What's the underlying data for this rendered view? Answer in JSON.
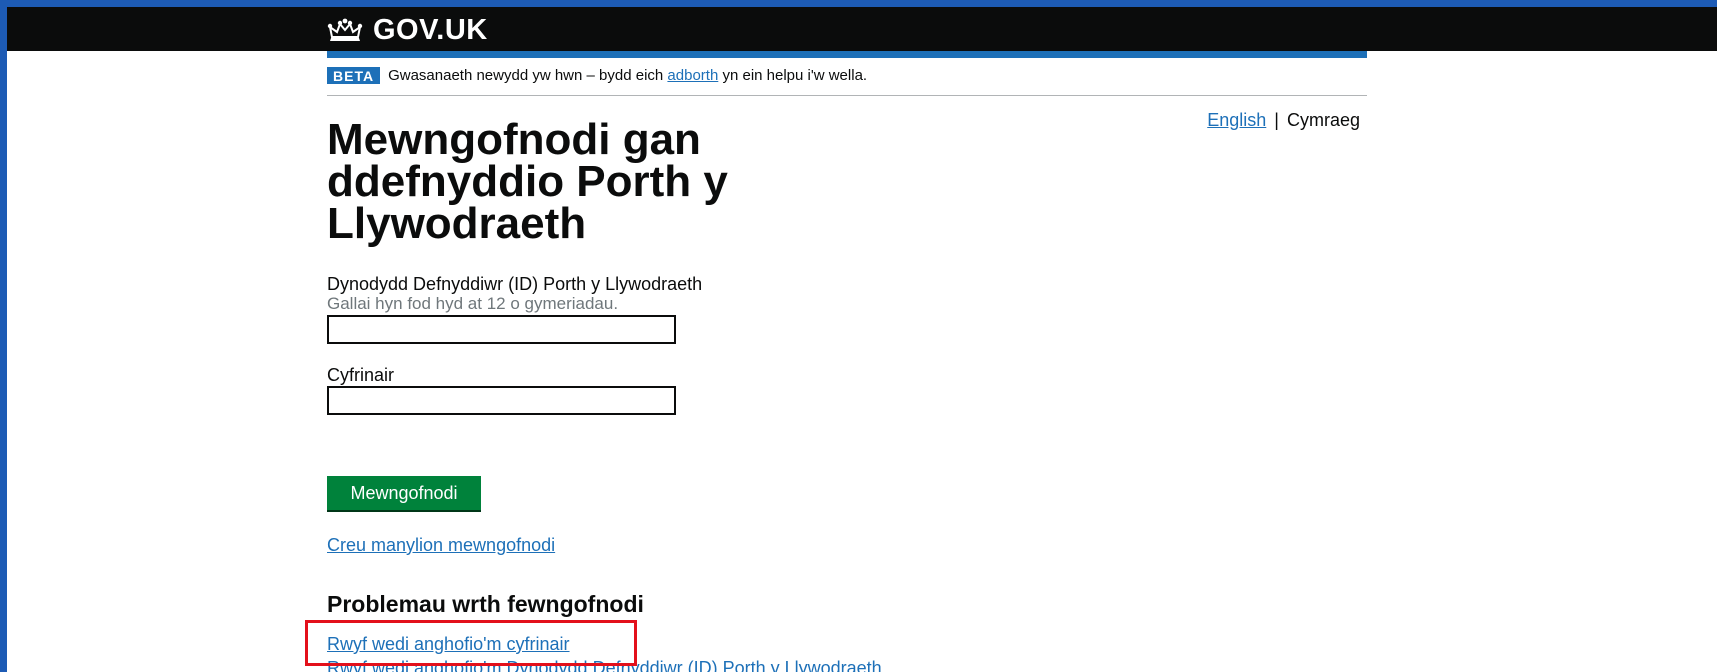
{
  "header": {
    "logo_text": "GOV.UK",
    "logo_icon": "crown-icon"
  },
  "phase_banner": {
    "tag": "BETA",
    "text_before": "Gwasanaeth newydd yw hwn – bydd eich",
    "feedback_link": "adborth",
    "text_after": "yn ein helpu i'w wella."
  },
  "language": {
    "english": "English",
    "separator": "|",
    "welsh": "Cymraeg"
  },
  "main": {
    "title": "Mewngofnodi gan ddefnyddio Porth y Llywodraeth",
    "user_id_label": "Dynodydd Defnyddiwr (ID) Porth y Llywodraeth",
    "user_id_hint": "Gallai hyn fod hyd at 12 o gymeriadau.",
    "user_id_value": "",
    "password_label": "Cyfrinair",
    "password_value": "",
    "sign_in_button": "Mewngofnodi",
    "create_link": "Creu manylion mewngofnodi",
    "problems_heading": "Problemau wrth fewngofnodi",
    "forgot_password_link": "Rwyf wedi anghofio'm cyfrinair",
    "forgot_id_link": "Rwyf wedi anghofio'm Dynodydd Defnyddiwr (ID) Porth y Llywodraeth"
  },
  "colors": {
    "header_bg": "#0b0c0c",
    "brand_blue": "#1d70b8",
    "button_green": "#00823b",
    "highlight_red": "#e3101b"
  }
}
